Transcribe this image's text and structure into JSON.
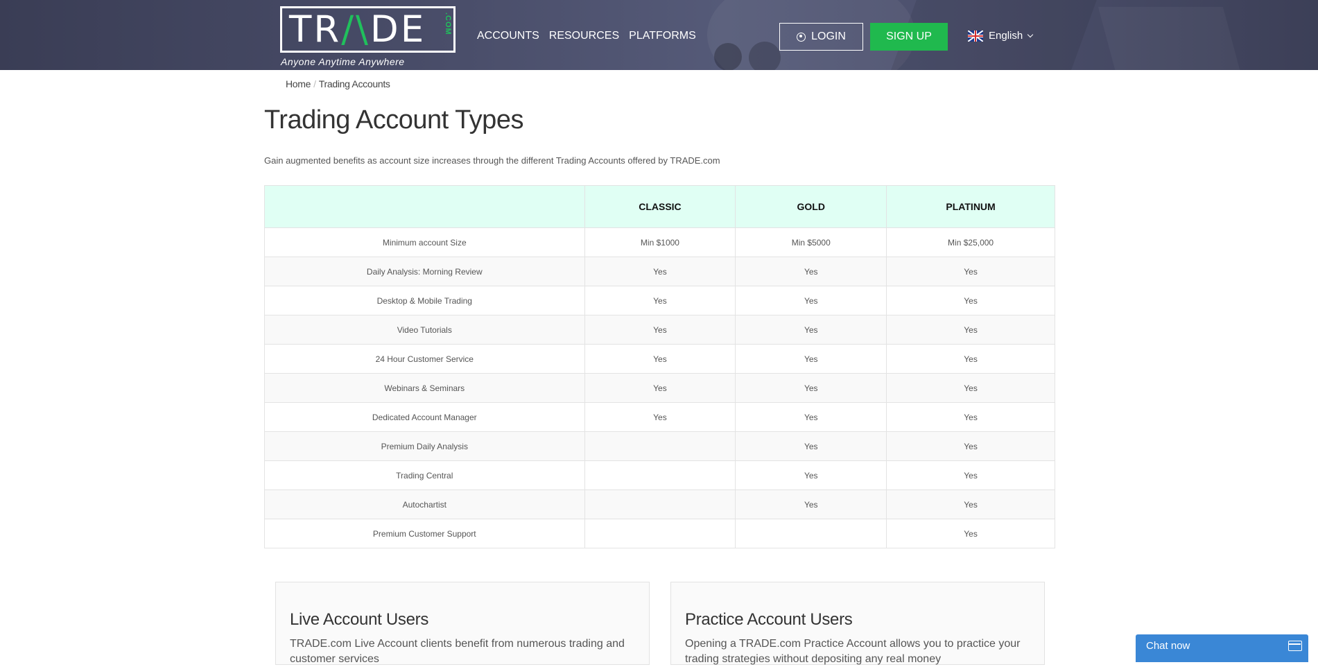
{
  "header": {
    "logo_text_1": "TR",
    "logo_text_a": "/\\",
    "logo_text_2": "DE",
    "logo_com": ".COM",
    "tagline": "Anyone Anytime Anywhere",
    "nav": [
      "ACCOUNTS",
      "RESOURCES",
      "PLATFORMS"
    ],
    "login_label": "LOGIN",
    "signup_label": "SIGN UP",
    "language": "English",
    "accent_color": "#20b94e"
  },
  "breadcrumb": {
    "home": "Home",
    "separator": "/",
    "current": "Trading Accounts"
  },
  "page": {
    "title": "Trading Account Types",
    "intro": "Gain augmented benefits as account size increases through the different Trading Accounts offered by TRADE.com"
  },
  "table": {
    "headers": [
      "",
      "CLASSIC",
      "GOLD",
      "PLATINUM"
    ],
    "rows": [
      [
        "Minimum account Size",
        "Min $1000",
        "Min $5000",
        "Min $25,000"
      ],
      [
        "Daily Analysis: Morning Review",
        "Yes",
        "Yes",
        "Yes"
      ],
      [
        "Desktop & Mobile Trading",
        "Yes",
        "Yes",
        "Yes"
      ],
      [
        "Video Tutorials",
        "Yes",
        "Yes",
        "Yes"
      ],
      [
        "24 Hour Customer Service",
        "Yes",
        "Yes",
        "Yes"
      ],
      [
        "Webinars & Seminars",
        "Yes",
        "Yes",
        "Yes"
      ],
      [
        "Dedicated Account Manager",
        "Yes",
        "Yes",
        "Yes"
      ],
      [
        "Premium Daily Analysis",
        "",
        "Yes",
        "Yes"
      ],
      [
        "Trading Central",
        "",
        "Yes",
        "Yes"
      ],
      [
        "Autochartist",
        "",
        "Yes",
        "Yes"
      ],
      [
        "Premium Customer Support",
        "",
        "",
        "Yes"
      ]
    ]
  },
  "cards": [
    {
      "title": "Live Account Users",
      "text": "TRADE.com Live Account clients benefit from numerous trading and customer services"
    },
    {
      "title": "Practice Account Users",
      "text": "Opening a TRADE.com Practice Account allows you to practice your trading strategies without depositing any real money"
    }
  ],
  "chat": {
    "label": "Chat now"
  }
}
